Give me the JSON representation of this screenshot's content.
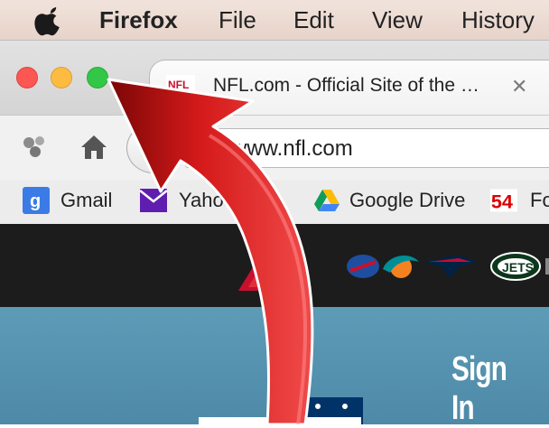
{
  "menubar": {
    "apple_icon": "apple-icon",
    "app_name": "Firefox",
    "items": [
      "File",
      "Edit",
      "View",
      "History"
    ]
  },
  "tab": {
    "favicon": "nfl-favicon",
    "favicon_text": "NFL",
    "title": "NFL.com - Official Site of the …",
    "close_glyph": "✕"
  },
  "toolbar": {
    "url": "www.nfl.com"
  },
  "bookmarks": [
    {
      "label": "Gmail",
      "icon": "google-icon"
    },
    {
      "label": "Yahoo! Ma",
      "icon": "yahoo-icon"
    },
    {
      "label": "Google Drive",
      "icon": "drive-icon"
    },
    {
      "label": "Fo",
      "icon": "fox-54-icon",
      "icon_text": "54"
    }
  ],
  "page": {
    "sign_in": "Sign In",
    "afc_text": "AFC"
  },
  "colors": {
    "menubar_bg": "#ecdcd4",
    "close": "#fc5753",
    "minimize": "#fdbc40",
    "maximize": "#33c748",
    "nfl_header": "#1c1c1c",
    "hero": "#5594b2",
    "arrow": "#d01a1a"
  }
}
